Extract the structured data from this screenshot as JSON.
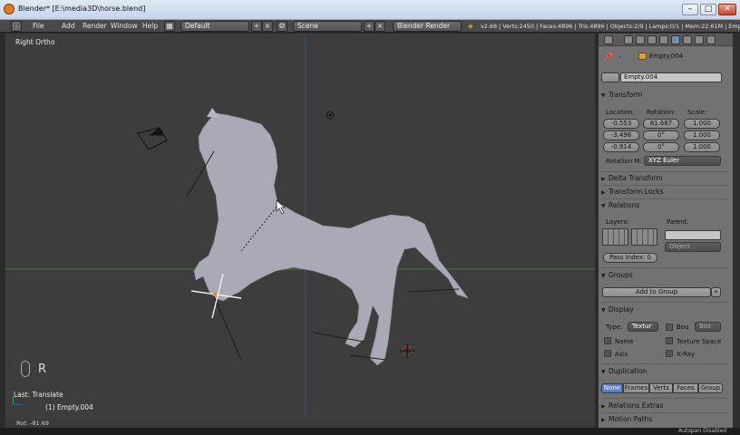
{
  "window": {
    "title": "Blender* [E:\\media3D\\horse.blend]",
    "minimize": "–",
    "maximize": "□",
    "close": "✕"
  },
  "menu": {
    "items": [
      "File",
      "Add",
      "Render",
      "Window",
      "Help"
    ],
    "layout": "Default",
    "scene": "Scene",
    "engine": "Blender Render",
    "stats": "v2.68 | Verts:2450 | Faces:4896 | Tris:4896 | Objects:2/9 | Lamps:0/1 | Mem:22.61M | Empty.004"
  },
  "viewport": {
    "view_label": "Right Ortho",
    "last_op": "Last: Translate",
    "object_label": "(1) Empty.004",
    "status": "Rot: -81.69",
    "overlay_key": "R"
  },
  "properties": {
    "breadcrumb": "Empty.004",
    "object_name": "Empty.004",
    "transform": {
      "title": "Transform",
      "location_label": "Location:",
      "rotation_label": "Rotation:",
      "scale_label": "Scale:",
      "location": [
        "-0.553",
        "-3.496",
        "-0.914"
      ],
      "rotation": [
        "81.687",
        "0°",
        "0°"
      ],
      "scale": [
        "1.000",
        "1.000",
        "1.000"
      ],
      "rotation_mode_label": "Rotation M:",
      "rotation_mode": "XYZ Euler"
    },
    "sections": {
      "delta": "Delta Transform",
      "locks": "Transform Locks",
      "relations": "Relations",
      "groups": "Groups",
      "display": "Display",
      "duplication": "Duplication",
      "relations_extras": "Relations Extras",
      "motion_paths": "Motion Paths"
    },
    "relations": {
      "layers_label": "Layers:",
      "parent_label": "Parent:",
      "parent_type": "Object",
      "pass_index": "Pass Index: 0"
    },
    "groups": {
      "add_label": "Add to Group"
    },
    "display": {
      "type_label": "Type:",
      "type_value": "Textur",
      "bounds_label": "Bou",
      "bounds_value": "Box",
      "name": "Name",
      "texture_space": "Texture Space",
      "axis": "Axis",
      "xray": "X-Ray"
    },
    "duplication": {
      "options": [
        "None",
        "Frames",
        "Verts",
        "Faces",
        "Group"
      ],
      "selected": "None"
    }
  },
  "footer": {
    "text": "Autopan Disabled"
  },
  "colors": {
    "accent": "#5680c2",
    "viewport_bg": "#3d3d3d",
    "panel_bg": "#727272",
    "grid_axis_green": "#3f7a3a"
  }
}
